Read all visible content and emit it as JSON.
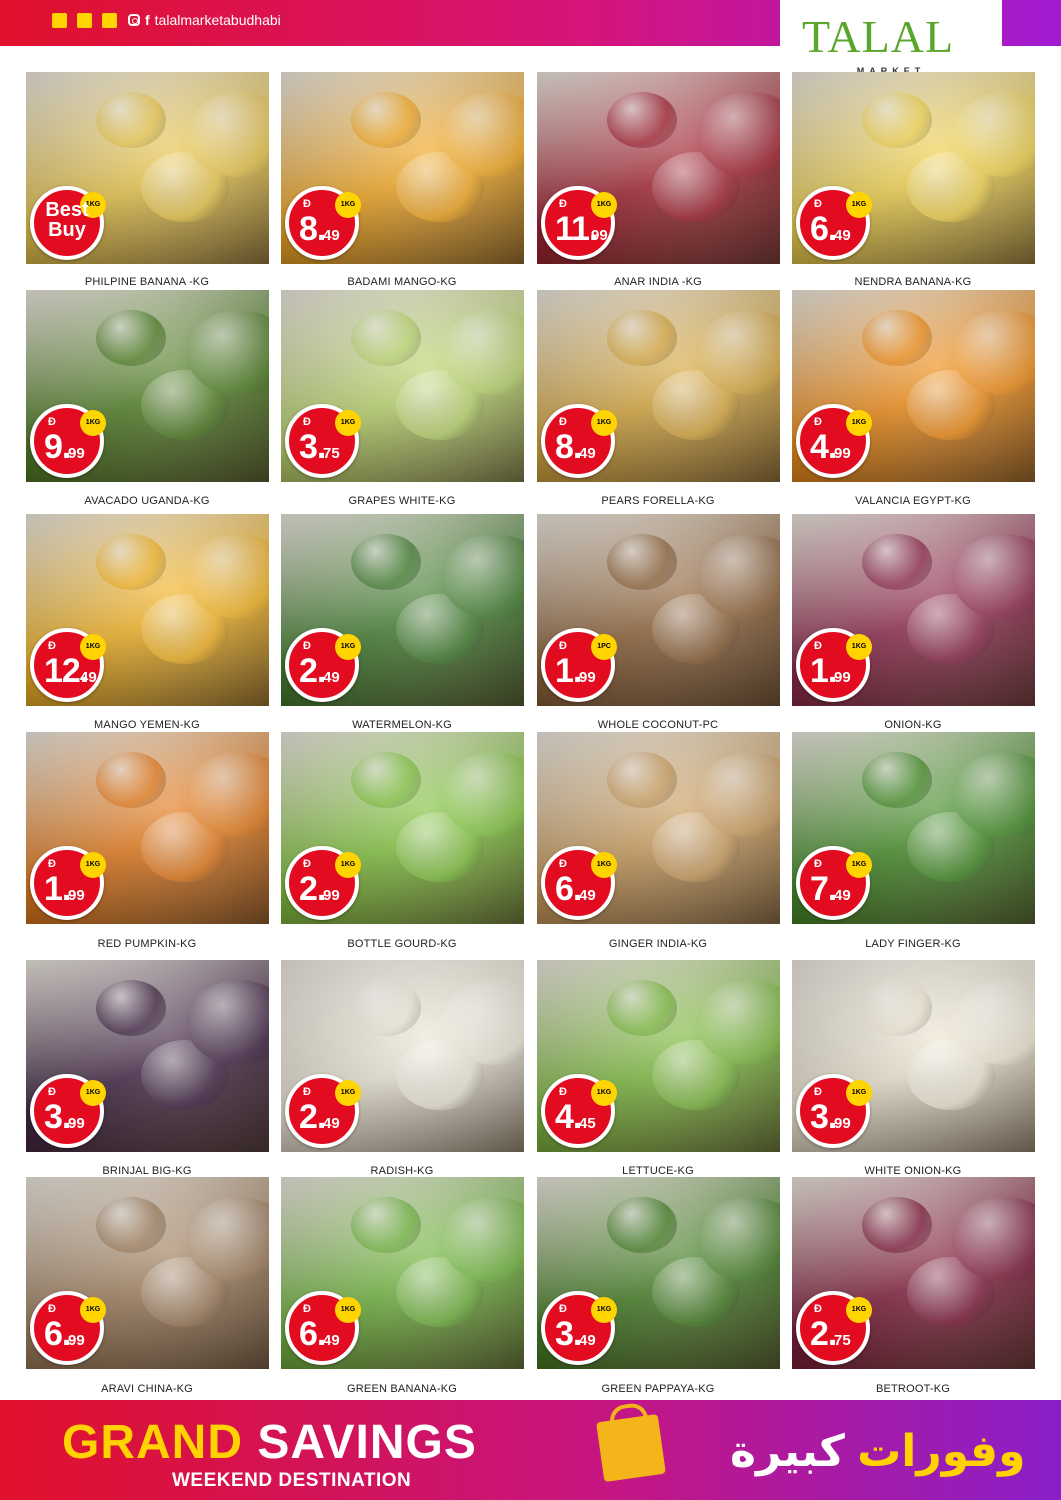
{
  "header": {
    "social_handle": "talalmarketabudhabi",
    "logo_word": "TALAL",
    "logo_sub": "MARKET"
  },
  "currency_symbol": "Đ",
  "products": [
    {
      "name": "PHILPINE BANANA -KG",
      "price_int": "",
      "price_dec": "",
      "unit": "1KG",
      "best_buy": "Best Buy",
      "color": "#e8c448"
    },
    {
      "name": "BADAMI MANGO-KG",
      "price_int": "8.",
      "price_dec": "49",
      "unit": "1KG",
      "color": "#f2a51c"
    },
    {
      "name": "ANAR INDIA -KG",
      "price_int": "11.",
      "price_dec": "99",
      "unit": "1KG",
      "color": "#9e1b2a"
    },
    {
      "name": "NENDRA BANANA-KG",
      "price_int": "6.",
      "price_dec": "49",
      "unit": "1KG",
      "color": "#f0d14a"
    },
    {
      "name": "AVACADO UGANDA-KG",
      "price_int": "9.",
      "price_dec": "99",
      "unit": "1KG",
      "color": "#4a7a1e"
    },
    {
      "name": "GRAPES WHITE-KG",
      "price_int": "3.",
      "price_dec": "75",
      "unit": "1KG",
      "color": "#b9d46a"
    },
    {
      "name": "PEARS FORELLA-KG",
      "price_int": "8.",
      "price_dec": "49",
      "unit": "1KG",
      "color": "#d6a53a"
    },
    {
      "name": "VALANCIA EGYPT-KG",
      "price_int": "4.",
      "price_dec": "99",
      "unit": "1KG",
      "color": "#f08a12"
    },
    {
      "name": "MANGO YEMEN-KG",
      "price_int": "12.",
      "price_dec": "49",
      "unit": "1KG",
      "color": "#f3b21f"
    },
    {
      "name": "WATERMELON-KG",
      "price_int": "2.",
      "price_dec": "49",
      "unit": "1KG",
      "color": "#3d7a2a"
    },
    {
      "name": "WHOLE COCONUT-PC",
      "price_int": "1.",
      "price_dec": "99",
      "unit": "1PC",
      "color": "#8a5e34"
    },
    {
      "name": "ONION-KG",
      "price_int": "1.",
      "price_dec": "99",
      "unit": "1KG",
      "color": "#8a2346"
    },
    {
      "name": "RED PUMPKIN-KG",
      "price_int": "1.",
      "price_dec": "99",
      "unit": "1KG",
      "color": "#e47716"
    },
    {
      "name": "BOTTLE GOURD-KG",
      "price_int": "2.",
      "price_dec": "99",
      "unit": "1KG",
      "color": "#7fc23a"
    },
    {
      "name": "GINGER INDIA-KG",
      "price_int": "6.",
      "price_dec": "49",
      "unit": "1KG",
      "color": "#c99a5a"
    },
    {
      "name": "LADY FINGER-KG",
      "price_int": "7.",
      "price_dec": "49",
      "unit": "1KG",
      "color": "#3f8a22"
    },
    {
      "name": "BRINJAL BIG-KG",
      "price_int": "3.",
      "price_dec": "99",
      "unit": "1KG",
      "color": "#3a1e3d"
    },
    {
      "name": "RADISH-KG",
      "price_int": "2.",
      "price_dec": "49",
      "unit": "1KG",
      "color": "#ece6d6"
    },
    {
      "name": "LETTUCE-KG",
      "price_int": "4.",
      "price_dec": "45",
      "unit": "1KG",
      "color": "#7ab83a"
    },
    {
      "name": "WHITE ONION-KG",
      "price_int": "3.",
      "price_dec": "99",
      "unit": "1KG",
      "color": "#ede6d2"
    },
    {
      "name": "ARAVI CHINA-KG",
      "price_int": "6.",
      "price_dec": "99",
      "unit": "1KG",
      "color": "#9c7a58"
    },
    {
      "name": "GREEN BANANA-KG",
      "price_int": "6.",
      "price_dec": "49",
      "unit": "1KG",
      "color": "#6db33a"
    },
    {
      "name": "GREEN PAPPAYA-KG",
      "price_int": "3.",
      "price_dec": "49",
      "unit": "1KG",
      "color": "#3f7a1e"
    },
    {
      "name": "BETROOT-KG",
      "price_int": "2.",
      "price_dec": "75",
      "unit": "1KG",
      "color": "#7a1534"
    }
  ],
  "footer": {
    "grand": "GRAND",
    "savings": "SAVINGS",
    "weekend": "WEEKEND DESTINATION",
    "arabic_1": "وفورات",
    "arabic_2": "كبيرة"
  }
}
